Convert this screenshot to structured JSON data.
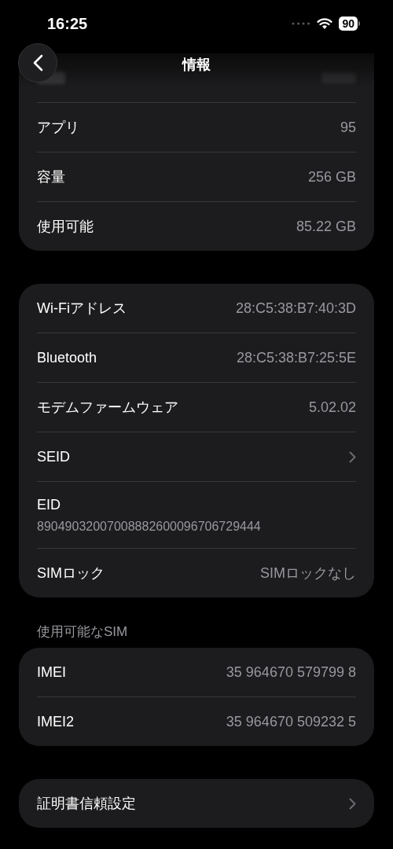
{
  "status_bar": {
    "time": "16:25",
    "battery": "90"
  },
  "nav": {
    "title": "情報"
  },
  "groups": [
    {
      "rows": [
        {
          "kind": "obscured"
        },
        {
          "kind": "value",
          "label": "アプリ",
          "value": "95"
        },
        {
          "kind": "value",
          "label": "容量",
          "value": "256 GB"
        },
        {
          "kind": "value",
          "label": "使用可能",
          "value": "85.22 GB"
        }
      ]
    },
    {
      "rows": [
        {
          "kind": "value",
          "label": "Wi-Fiアドレス",
          "value": "28:C5:38:B7:40:3D"
        },
        {
          "kind": "value",
          "label": "Bluetooth",
          "value": "28:C5:38:B7:25:5E"
        },
        {
          "kind": "value",
          "label": "モデムファームウェア",
          "value": "5.02.02"
        },
        {
          "kind": "link",
          "label": "SEID"
        },
        {
          "kind": "stacked",
          "label": "EID",
          "value": "89049032007008882600096706729444"
        },
        {
          "kind": "value",
          "label": "SIMロック",
          "value": "SIMロックなし"
        }
      ]
    },
    {
      "header": "使用可能なSIM",
      "rows": [
        {
          "kind": "value",
          "label": "IMEI",
          "value": "35 964670 579799 8"
        },
        {
          "kind": "value",
          "label": "IMEI2",
          "value": "35 964670 509232 5"
        }
      ]
    },
    {
      "rows": [
        {
          "kind": "link",
          "label": "証明書信頼設定"
        }
      ]
    }
  ]
}
